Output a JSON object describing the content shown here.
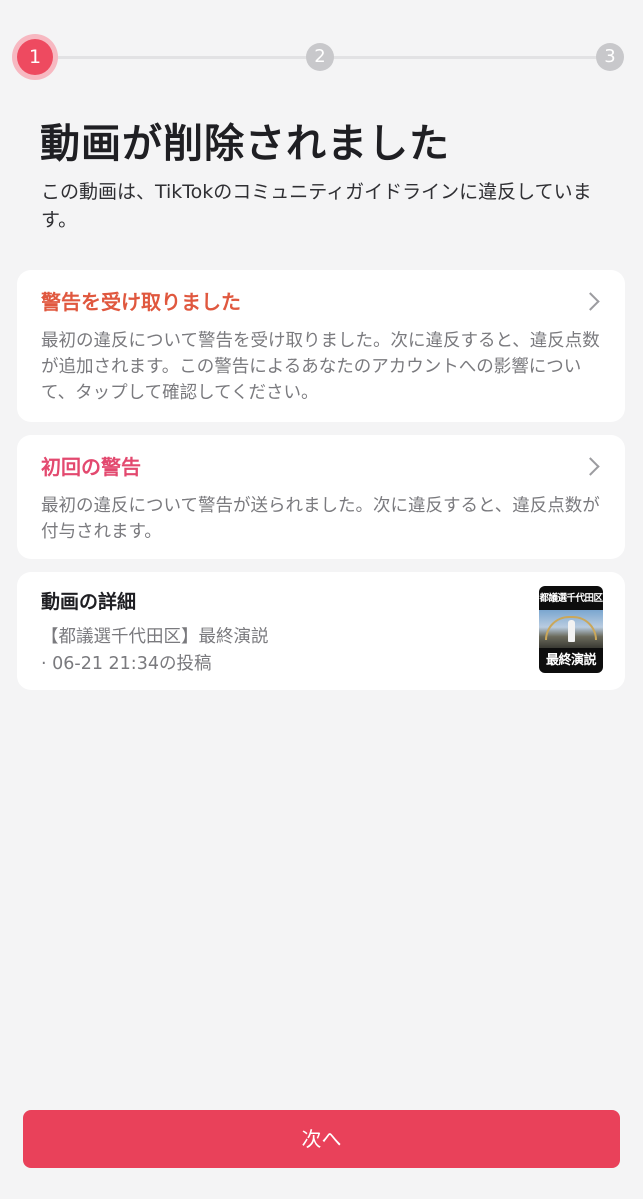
{
  "stepper": {
    "steps": [
      "1",
      "2",
      "3"
    ],
    "active_index": 0,
    "colors": {
      "active": "#ee4a60",
      "inactive": "#c8c8cb"
    }
  },
  "header": {
    "title": "動画が削除されました",
    "subtitle": "この動画は、TikTokのコミュニティガイドラインに違反しています。"
  },
  "cards": {
    "warning": {
      "title": "警告を受け取りました",
      "body": "最初の違反について警告を受け取りました。次に違反すると、違反点数が追加されます。この警告によるあなたのアカウントへの影響について、タップして確認してください。",
      "icon": "chevron-right-icon"
    },
    "first_warning": {
      "title": "初回の警告",
      "body": "最初の違反について警告が送られました。次に違反すると、違反点数が付与されます。",
      "icon": "chevron-right-icon"
    },
    "detail": {
      "title": "動画の詳細",
      "video_title": "【都議選千代田区】最終演説",
      "posted": "· 06-21 21:34の投稿",
      "thumbnail": {
        "top_text": "都議選千代田区",
        "bottom_text": "最終演説"
      }
    }
  },
  "footer": {
    "next_label": "次へ",
    "color": "#e9415a"
  }
}
